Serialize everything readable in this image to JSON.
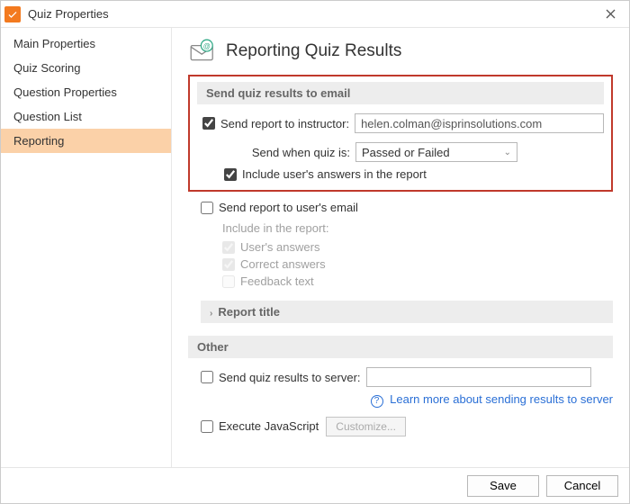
{
  "window": {
    "title": "Quiz Properties"
  },
  "sidebar": {
    "items": [
      {
        "label": "Main Properties",
        "selected": false
      },
      {
        "label": "Quiz Scoring",
        "selected": false
      },
      {
        "label": "Question Properties",
        "selected": false
      },
      {
        "label": "Question List",
        "selected": false
      },
      {
        "label": "Reporting",
        "selected": true
      }
    ]
  },
  "page": {
    "title": "Reporting Quiz Results"
  },
  "email_section": {
    "header": "Send quiz results to email",
    "send_instructor_label": "Send report to instructor:",
    "instructor_email": "helen.colman@isprinsolutions.com",
    "send_when_label": "Send when quiz is:",
    "send_when_value": "Passed or Failed",
    "include_answers_label": "Include user's answers in the report",
    "send_user_label": "Send report to user's email",
    "include_header": "Include in the report:",
    "opt_user_answers": "User's answers",
    "opt_correct_answers": "Correct answers",
    "opt_feedback": "Feedback text",
    "report_title_header": "Report title"
  },
  "other_section": {
    "header": "Other",
    "send_server_label": "Send quiz results to server:",
    "learn_more": "Learn more about sending results to server",
    "exec_js_label": "Execute JavaScript",
    "customize_label": "Customize..."
  },
  "footer": {
    "save": "Save",
    "cancel": "Cancel"
  }
}
